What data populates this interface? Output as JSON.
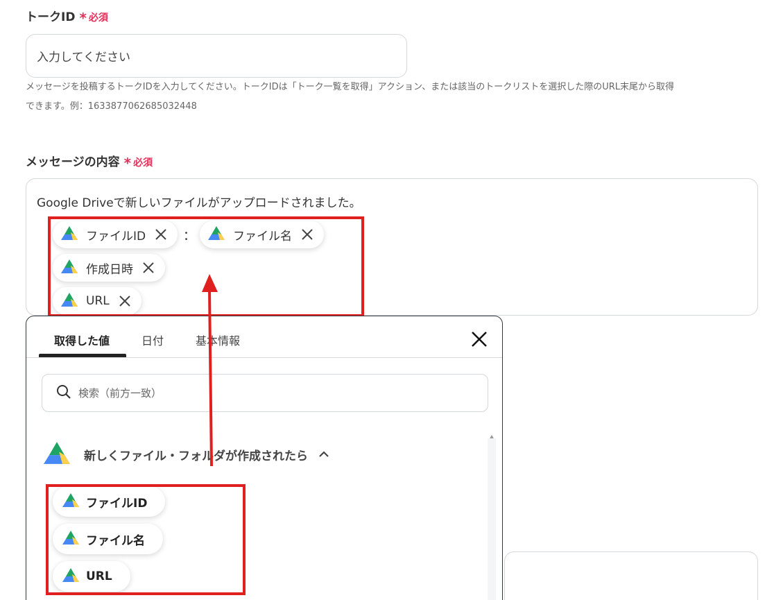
{
  "talk_id": {
    "label": "トークID",
    "required_mark": "*",
    "required_text": "必須",
    "placeholder": "入力してください",
    "help_line1": "メッセージを投稿するトークIDを入力してください。トークIDは「トーク一覧を取得」アクション、または該当のトークリストを選択した際のURL末尾から取得",
    "help_line2": "できます。例：1633877062685032448"
  },
  "message": {
    "label": "メッセージの内容",
    "required_mark": "*",
    "required_text": "必須",
    "text": "Google Driveで新しいファイルがアップロードされました。",
    "colon": "：",
    "chips": [
      {
        "label": "ファイルID",
        "icon": "google-drive-icon"
      },
      {
        "label": "ファイル名",
        "icon": "google-drive-icon"
      },
      {
        "label": "作成日時",
        "icon": "google-drive-icon"
      },
      {
        "label": "URL",
        "icon": "google-drive-icon"
      }
    ]
  },
  "picker": {
    "tabs": [
      "取得した値",
      "日付",
      "基本情報"
    ],
    "active_tab": "取得した値",
    "search_placeholder": "検索（前方一致）",
    "section_title": "新しくファイル・フォルダが作成されたら",
    "values": [
      {
        "label": "ファイルID",
        "icon": "google-drive-icon"
      },
      {
        "label": "ファイル名",
        "icon": "google-drive-icon"
      },
      {
        "label": "URL",
        "icon": "google-drive-icon"
      }
    ]
  },
  "colors": {
    "required": "#e2305a",
    "highlight_box": "#e0201f",
    "drive_green": "#1fa463",
    "drive_yellow": "#ffd04b",
    "drive_blue": "#4688f4"
  }
}
